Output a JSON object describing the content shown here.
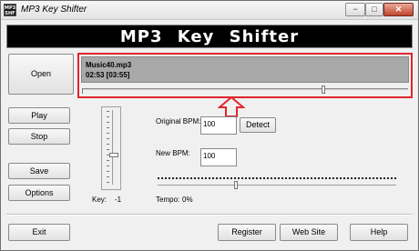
{
  "window": {
    "title": "MP3 Key Shifter",
    "icon_name": "app-logo-icon",
    "icon_text": "MP3 SHF",
    "controls": {
      "minimize": "−",
      "maximize": "□",
      "close": "✕"
    }
  },
  "banner": {
    "text": "MP3 Key Shifter"
  },
  "buttons": {
    "open": "Open",
    "play": "Play",
    "stop": "Stop",
    "save": "Save",
    "options": "Options",
    "detect": "Detect",
    "exit": "Exit",
    "register": "Register",
    "website": "Web Site",
    "help": "Help"
  },
  "track": {
    "filename": "Music40.mp3",
    "time": "02:53 [03:55]",
    "position_fraction": 0.736
  },
  "key": {
    "label": "Key:",
    "value": "-1"
  },
  "bpm": {
    "original_label": "Original BPM:",
    "original_value": "100",
    "new_label": "New BPM:",
    "new_value": "100"
  },
  "tempo": {
    "label": "Tempo:",
    "value": "0%"
  },
  "colors": {
    "highlight": "#e0262d",
    "track_bg": "#a8a8a8",
    "banner_bg": "#000000"
  }
}
